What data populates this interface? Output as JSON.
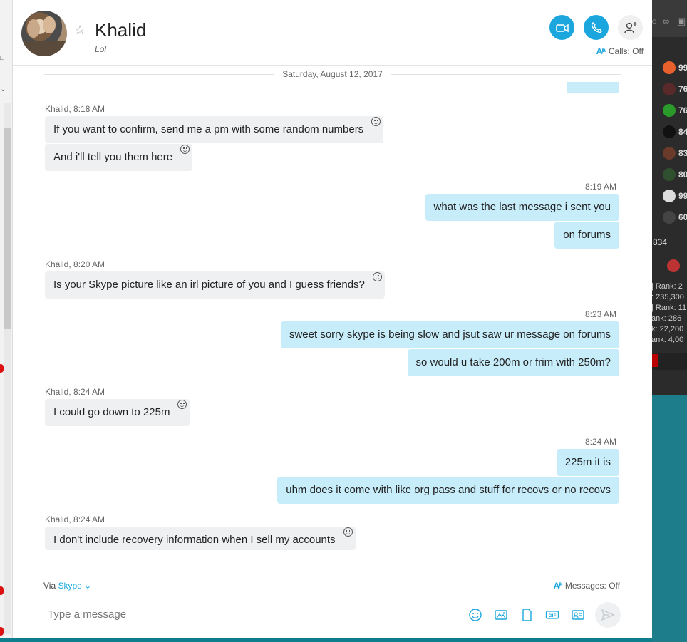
{
  "contact": {
    "name": "Khalid",
    "mood": "Lol",
    "calls_status": "Calls: Off"
  },
  "conversation": {
    "date": "Saturday, August 12, 2017",
    "groups": [
      {
        "sender": "Khalid, 8:18 AM",
        "messages": [
          "If you want to confirm, send me a pm with some random numbers",
          "And i'll tell you them here"
        ]
      },
      {
        "time": "8:19 AM",
        "messages": [
          "what was the last message i sent you",
          "on forums"
        ]
      },
      {
        "sender": "Khalid, 8:20 AM",
        "messages": [
          "Is your Skype picture like an irl picture of you and I guess friends?"
        ]
      },
      {
        "time": "8:23 AM",
        "messages": [
          "sweet sorry skype is being slow and jsut saw ur message on forums",
          "so would u take 200m or frim with 250m?"
        ]
      },
      {
        "sender": "Khalid, 8:24 AM",
        "messages": [
          "I could go down to 225m"
        ]
      },
      {
        "time": "8:24 AM",
        "messages": [
          "225m it is",
          "uhm does it come with like org pass and stuff for recovs or no recovs"
        ]
      },
      {
        "sender": "Khalid, 8:24 AM",
        "messages": [
          "I don't include recovery information when I sell my accounts"
        ]
      }
    ]
  },
  "compose": {
    "via_label": "Via",
    "via_service": "Skype",
    "messages_status": "Messages: Off",
    "placeholder": "Type a message"
  },
  "game_panel": {
    "stats": [
      "99",
      "76",
      "76",
      "84",
      "83",
      "80",
      "99",
      "60"
    ],
    "total": "834",
    "ranks": [
      "| Rank: 2",
      ": 235,300",
      "| Rank: 11",
      "ank: 286",
      "k: 22,200",
      "ank: 4,00"
    ]
  },
  "colors": {
    "accent": "#1ba7dd",
    "outgoing_bubble": "#c7ecfa",
    "incoming_bubble": "#eef0f2"
  }
}
